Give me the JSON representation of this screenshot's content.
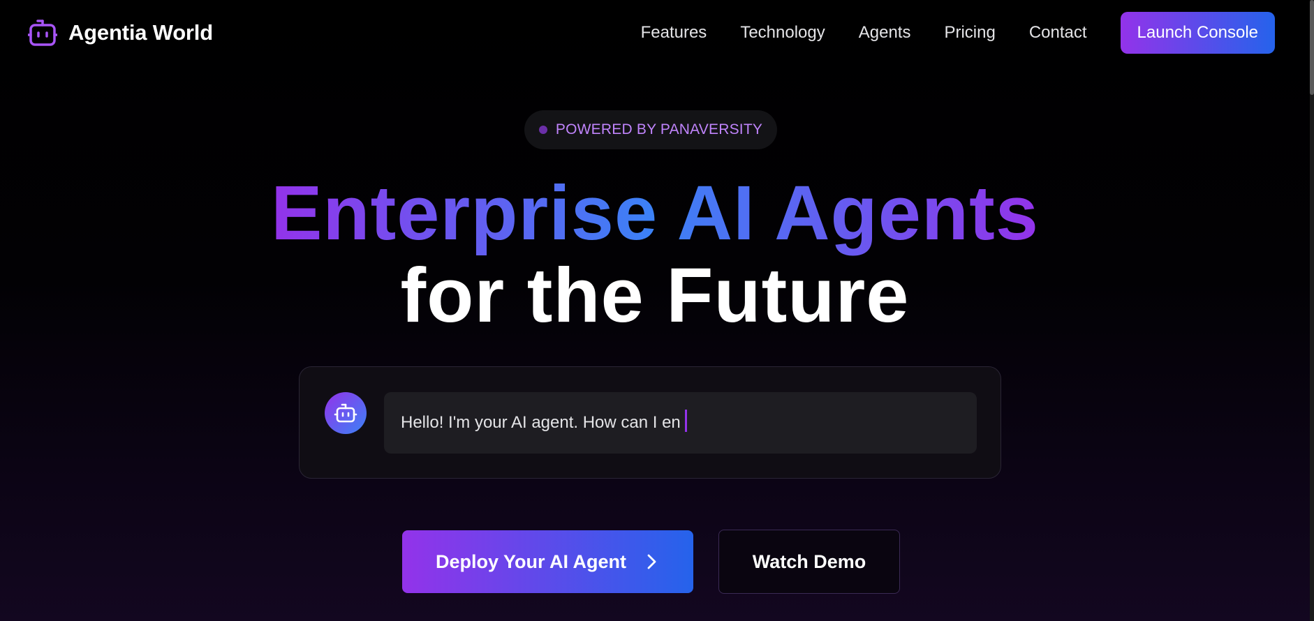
{
  "brand": {
    "name": "Agentia World",
    "icon": "robot-icon",
    "accent": "#9333ea"
  },
  "nav": {
    "items": [
      "Features",
      "Technology",
      "Agents",
      "Pricing",
      "Contact"
    ],
    "cta_label": "Launch Console"
  },
  "hero": {
    "badge": "POWERED BY PANAVERSITY",
    "headline_gradient": "Enterprise AI Agents",
    "headline_plain": "for the Future"
  },
  "chat": {
    "avatar_icon": "robot-icon",
    "message": "Hello! I'm your AI agent. How can I en"
  },
  "cta": {
    "primary_label": "Deploy Your AI Agent",
    "primary_icon": "chevron-right-icon",
    "secondary_label": "Watch Demo"
  },
  "colors": {
    "gradient_start": "#9333ea",
    "gradient_end": "#2563eb",
    "background": "#000000"
  }
}
